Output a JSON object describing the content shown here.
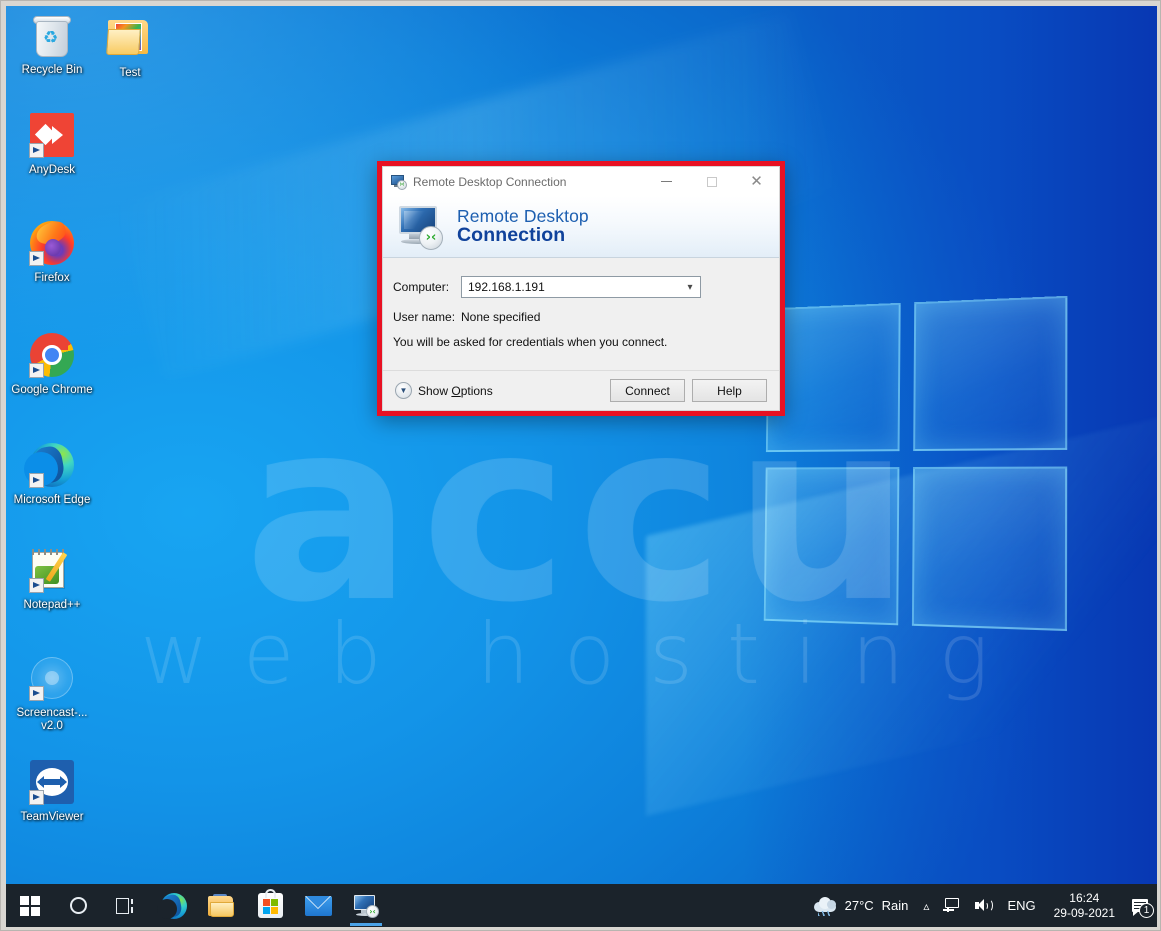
{
  "desktop": {
    "wallpaper_watermark": {
      "main": "accu",
      "sub": "web hosting"
    },
    "icons": [
      {
        "label": "Recycle Bin",
        "icon": "recycle-bin-icon",
        "shortcut": false
      },
      {
        "label": "Test",
        "icon": "folder-icon",
        "shortcut": false
      },
      {
        "label": "AnyDesk",
        "icon": "anydesk-icon",
        "shortcut": true
      },
      {
        "label": "Firefox",
        "icon": "firefox-icon",
        "shortcut": true
      },
      {
        "label": "Google Chrome",
        "icon": "chrome-icon",
        "shortcut": true
      },
      {
        "label": "Microsoft Edge",
        "icon": "edge-icon",
        "shortcut": true
      },
      {
        "label": "Notepad++",
        "icon": "notepad-plus-plus-icon",
        "shortcut": true
      },
      {
        "label": "Screencast-...\nv2.0",
        "icon": "disc-icon",
        "shortcut": true
      },
      {
        "label": "TeamViewer",
        "icon": "teamviewer-icon",
        "shortcut": true
      }
    ]
  },
  "rdp_dialog": {
    "title": "Remote Desktop Connection",
    "title_icon": "remote-desktop-icon",
    "window_buttons": {
      "minimize": "—",
      "maximize": "□",
      "close": "✕"
    },
    "brand": {
      "line1": "Remote Desktop",
      "line2": "Connection",
      "icon": "remote-desktop-monitor-icon"
    },
    "fields": {
      "computer_label": "Computer:",
      "computer_value": "192.168.1.191",
      "computer_dropdown_icon": "chevron-down-icon",
      "username_label": "User name:",
      "username_value": "None specified",
      "hint": "You will be asked for credentials when you connect."
    },
    "footer": {
      "show_options_label_pre": "Show ",
      "show_options_accel": "O",
      "show_options_label_post": "ptions",
      "show_options_icon": "chevron-down-circle-icon",
      "connect_label": "Connect",
      "help_label": "Help"
    },
    "highlight_color": "#e81123"
  },
  "taskbar": {
    "start_icon": "windows-start-icon",
    "search_icon": "cortana-search-icon",
    "taskview_icon": "task-view-icon",
    "pinned": [
      {
        "name": "edge-taskbar-icon",
        "active": false
      },
      {
        "name": "file-explorer-taskbar-icon",
        "active": false
      },
      {
        "name": "microsoft-store-taskbar-icon",
        "active": false
      },
      {
        "name": "mail-taskbar-icon",
        "active": false
      },
      {
        "name": "remote-desktop-taskbar-icon",
        "active": true
      }
    ],
    "tray": {
      "weather_icon": "rain-cloud-icon",
      "weather_temp": "27°C",
      "weather_condition": "Rain",
      "overflow_icon": "chevron-up-icon",
      "network_icon": "network-icon",
      "volume_icon": "volume-icon",
      "language": "ENG",
      "time": "16:24",
      "date": "29-09-2021",
      "notification_icon": "action-center-icon",
      "notification_count": "1"
    }
  }
}
